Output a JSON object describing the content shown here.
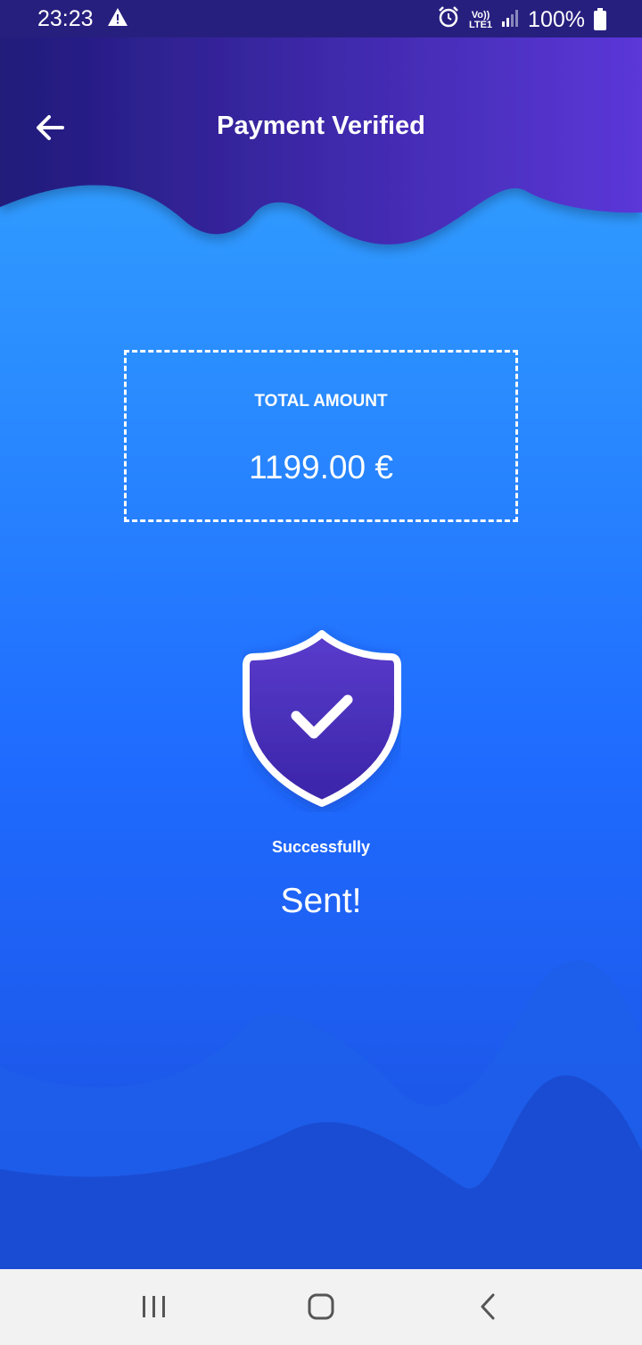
{
  "status_bar": {
    "time": "23:23",
    "network": "LTE1",
    "network_top": "Vo))",
    "battery": "100%"
  },
  "header": {
    "title": "Payment Verified"
  },
  "amount": {
    "label": "TOTAL AMOUNT",
    "value": "1199.00 €"
  },
  "result": {
    "subtitle": "Successfully",
    "title": "Sent!"
  },
  "colors": {
    "header_start": "#201a7a",
    "header_end": "#5b37d8",
    "body_top": "#35a8ff",
    "body_bottom": "#1b4fe0",
    "shield": "#4b2fbf"
  },
  "icons": {
    "back": "arrow-left-icon",
    "shield": "shield-check-icon",
    "nav_recents": "recents-icon",
    "nav_home": "home-icon",
    "nav_back": "chevron-left-icon"
  }
}
